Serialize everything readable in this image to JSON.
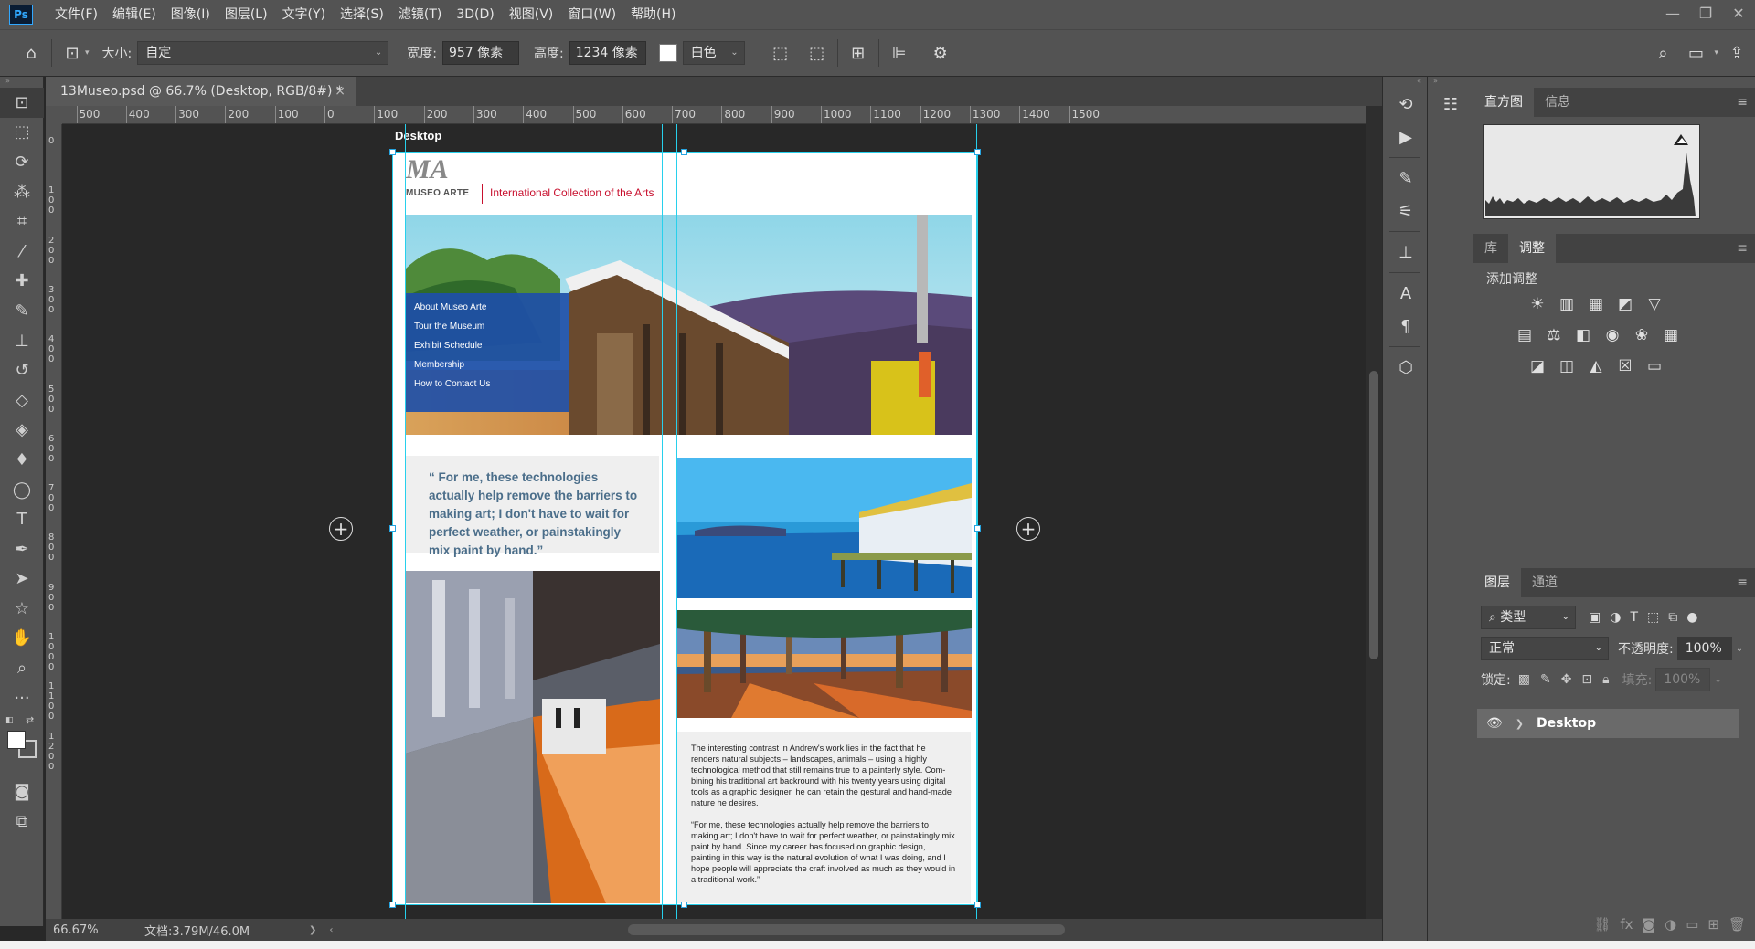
{
  "app": {
    "logo": "Ps"
  },
  "menu": [
    "文件(F)",
    "编辑(E)",
    "图像(I)",
    "图层(L)",
    "文字(Y)",
    "选择(S)",
    "滤镜(T)",
    "3D(D)",
    "视图(V)",
    "窗口(W)",
    "帮助(H)"
  ],
  "window_controls": {
    "minimize": "—",
    "restore": "❐",
    "close": "✕"
  },
  "options": {
    "size_label": "大小:",
    "size_value": "自定",
    "width_label": "宽度:",
    "width_value": "957 像素",
    "height_label": "高度:",
    "height_value": "1234 像素",
    "bg_value": "白色"
  },
  "document": {
    "tab_title": "13Museo.psd @ 66.7% (Desktop, RGB/8#) *",
    "tab_close": "×",
    "artboard_name": "Desktop",
    "zoom": "66.67%",
    "doc_size": "文档:3.79M/46.0M",
    "status_arrow": "❯"
  },
  "ruler": {
    "top": [
      "500",
      "400",
      "300",
      "200",
      "100",
      "0",
      "100",
      "200",
      "300",
      "400",
      "500",
      "600",
      "700",
      "800",
      "900",
      "1000",
      "1100",
      "1200",
      "1300",
      "1400",
      "1500"
    ],
    "left": [
      "0",
      "100",
      "200",
      "300",
      "400",
      "500",
      "600",
      "700",
      "800",
      "900",
      "1000",
      "1100",
      "1200"
    ]
  },
  "site": {
    "logo_mark": "MA",
    "logo_name": "MUSEO ARTE",
    "tagline": "International Collection of the Arts",
    "nav": [
      "About Museo Arte",
      "Tour the Museum",
      "Exhibit Schedule",
      "Membership",
      "How to Contact Us"
    ],
    "quote": "“ For me, these technologies actually help remove the barriers to making art; I don't have to wait for perfect weather, or painstakingly mix paint by hand.”",
    "body_p1": "The interesting contrast in Andrew's work lies in the fact that he renders natural subjects – landscapes, animals – using a highly technological method that still remains true to a painterly style. Com-bining his traditional art backround with his twenty years using digital tools as a graphic designer, he can retain the gestural and hand-made nature he desires.",
    "body_p2": "“For me, these technologies actually help remove the barriers to making art; I don't have to wait for perfect weather, or painstakingly mix paint by hand. Since my career has focused on graphic design, painting in this way is the natural evolution of what I was doing, and I hope people will appreciate the craft involved as much as they would in a traditional work.”"
  },
  "panels": {
    "histogram_tab": "直方图",
    "info_tab": "信息",
    "library_tab": "库",
    "adjust_tab": "调整",
    "add_adjustment": "添加调整",
    "layers_tab": "图层",
    "channels_tab": "通道",
    "filter_kind": "类型",
    "blend_mode": "正常",
    "opacity_label": "不透明度:",
    "opacity_value": "100%",
    "lock_label": "锁定:",
    "fill_label": "填充:",
    "fill_value": "100%",
    "layer_name": "Desktop"
  },
  "colors": {
    "accent": "#31a8ff",
    "guide": "#27d0ec",
    "nav_blue": "#1e4fa8",
    "tagline_red": "#c8102e",
    "quote_blue": "#4b6e8a"
  }
}
